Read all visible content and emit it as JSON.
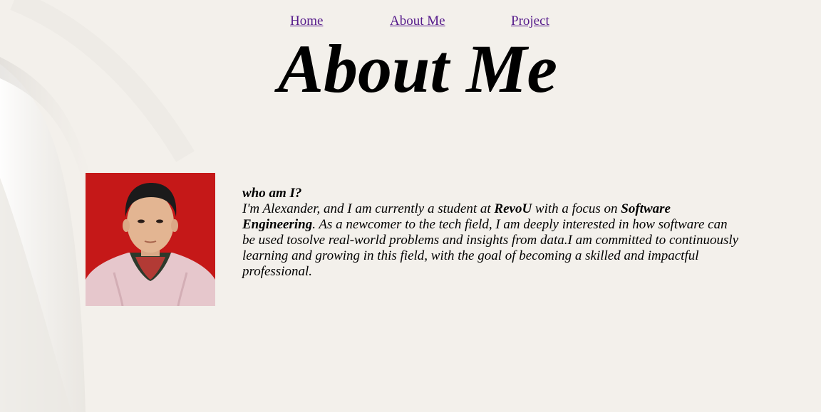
{
  "nav": {
    "home": "Home",
    "about": "About Me",
    "project": "Project"
  },
  "page": {
    "title": "About Me"
  },
  "profile": {
    "photo_icon": "person-portrait-photo",
    "photo_background": "#c51818"
  },
  "bio": {
    "heading": "who am I?",
    "intro_before_school": "I'm Alexander, and I am currently a student at ",
    "school": "RevoU",
    "mid_text": " with a focus on ",
    "focus": "Software Engineering",
    "rest": ". As a newcomer to the tech field, I am deeply interested in how software can be used tosolve real-world problems and insights from data.I am committed to continuously learning and growing in this field, with the goal of becoming a skilled and impactful professional."
  },
  "colors": {
    "link": "#551a8b",
    "background": "#f3f0eb"
  }
}
